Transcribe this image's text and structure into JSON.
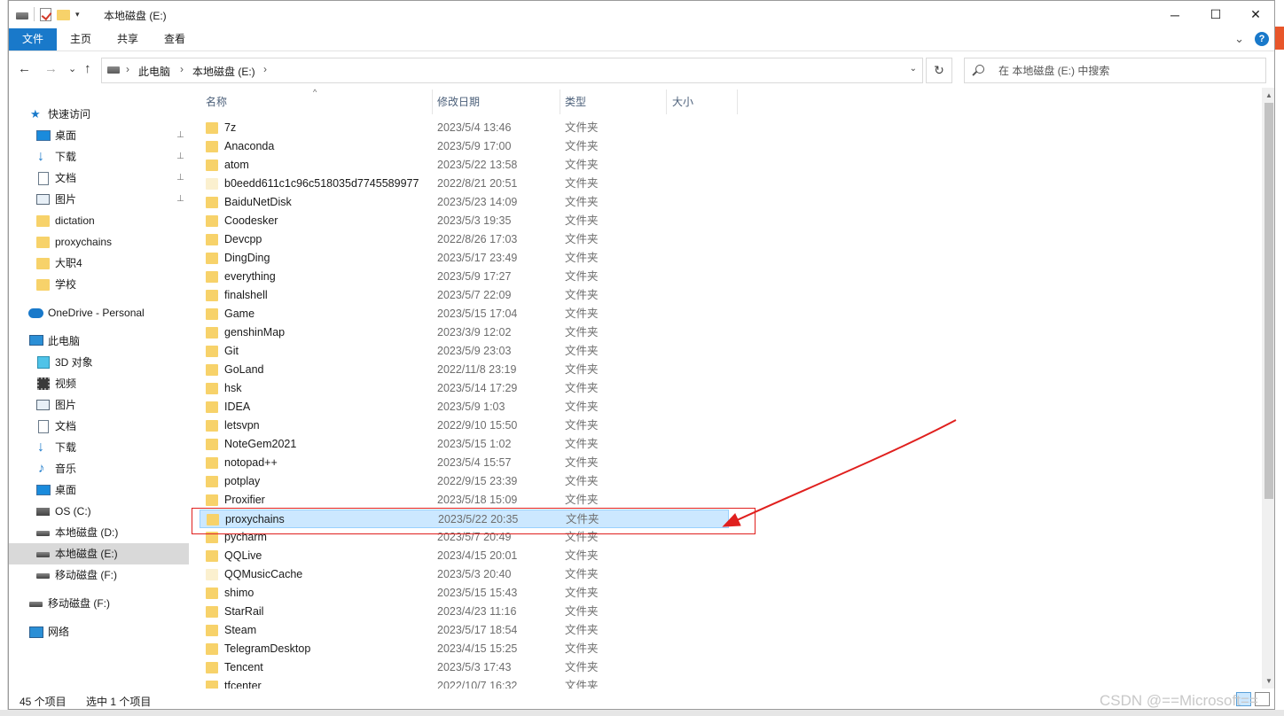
{
  "window": {
    "title": "本地磁盘 (E:)",
    "minimize_glyph": "─",
    "maximize_glyph": "☐",
    "close_glyph": "✕"
  },
  "ribbon": {
    "tabs": [
      "文件",
      "主页",
      "共享",
      "查看"
    ],
    "expand_glyph": "⌄",
    "help_glyph": "?"
  },
  "address": {
    "back_glyph": "←",
    "forward_glyph": "→",
    "recent_glyph": "⌄",
    "up_glyph": "↑",
    "crumbs": [
      "此电脑",
      "本地磁盘 (E:)"
    ],
    "crumb_sep": "›",
    "dropdown_glyph": "⌄",
    "refresh_glyph": "↻",
    "search_placeholder": "在 本地磁盘 (E:) 中搜索"
  },
  "sidebar": {
    "items": [
      {
        "label": "快速访问",
        "icon": "star-icon"
      },
      {
        "label": "桌面",
        "icon": "desktop-icon",
        "pinned": true
      },
      {
        "label": "下载",
        "icon": "download-icon",
        "pinned": true
      },
      {
        "label": "文档",
        "icon": "document-icon",
        "pinned": true
      },
      {
        "label": "图片",
        "icon": "picture-icon",
        "pinned": true
      },
      {
        "label": "dictation",
        "icon": "folder-icon"
      },
      {
        "label": "proxychains",
        "icon": "folder-icon"
      },
      {
        "label": "大职4",
        "icon": "folder-icon"
      },
      {
        "label": "学校",
        "icon": "folder-icon"
      },
      {
        "label": "OneDrive - Personal",
        "icon": "cloud-icon"
      },
      {
        "label": "此电脑",
        "icon": "computer-icon"
      },
      {
        "label": "3D 对象",
        "icon": "3d-objects-icon"
      },
      {
        "label": "视频",
        "icon": "video-icon"
      },
      {
        "label": "图片",
        "icon": "picture-icon"
      },
      {
        "label": "文档",
        "icon": "document-icon"
      },
      {
        "label": "下载",
        "icon": "download-icon"
      },
      {
        "label": "音乐",
        "icon": "music-icon"
      },
      {
        "label": "桌面",
        "icon": "desktop-icon"
      },
      {
        "label": "OS (C:)",
        "icon": "os-drive-icon"
      },
      {
        "label": "本地磁盘 (D:)",
        "icon": "drive-icon"
      },
      {
        "label": "本地磁盘 (E:)",
        "icon": "drive-icon",
        "selected": true
      },
      {
        "label": "移动磁盘 (F:)",
        "icon": "drive-icon"
      },
      {
        "label": "移动磁盘 (F:)",
        "icon": "drive-icon"
      },
      {
        "label": "网络",
        "icon": "network-icon"
      }
    ],
    "pin_glyph": "📌"
  },
  "columns": {
    "name": "名称",
    "date": "修改日期",
    "type": "类型",
    "size": "大小",
    "sort_glyph": "^"
  },
  "files": [
    {
      "name": "7z",
      "date": "2023/5/4 13:46",
      "type": "文件夹"
    },
    {
      "name": "Anaconda",
      "date": "2023/5/9 17:00",
      "type": "文件夹"
    },
    {
      "name": "atom",
      "date": "2023/5/22 13:58",
      "type": "文件夹"
    },
    {
      "name": "b0eedd611c1c96c518035d7745589977",
      "date": "2022/8/21 20:51",
      "type": "文件夹",
      "light": true
    },
    {
      "name": "BaiduNetDisk",
      "date": "2023/5/23 14:09",
      "type": "文件夹"
    },
    {
      "name": "Coodesker",
      "date": "2023/5/3 19:35",
      "type": "文件夹"
    },
    {
      "name": "Devcpp",
      "date": "2022/8/26 17:03",
      "type": "文件夹"
    },
    {
      "name": "DingDing",
      "date": "2023/5/17 23:49",
      "type": "文件夹"
    },
    {
      "name": "everything",
      "date": "2023/5/9 17:27",
      "type": "文件夹"
    },
    {
      "name": "finalshell",
      "date": "2023/5/7 22:09",
      "type": "文件夹"
    },
    {
      "name": "Game",
      "date": "2023/5/15 17:04",
      "type": "文件夹"
    },
    {
      "name": "genshinMap",
      "date": "2023/3/9 12:02",
      "type": "文件夹"
    },
    {
      "name": "Git",
      "date": "2023/5/9 23:03",
      "type": "文件夹"
    },
    {
      "name": "GoLand",
      "date": "2022/11/8 23:19",
      "type": "文件夹"
    },
    {
      "name": "hsk",
      "date": "2023/5/14 17:29",
      "type": "文件夹"
    },
    {
      "name": "IDEA",
      "date": "2023/5/9 1:03",
      "type": "文件夹"
    },
    {
      "name": "letsvpn",
      "date": "2022/9/10 15:50",
      "type": "文件夹"
    },
    {
      "name": "NoteGem2021",
      "date": "2023/5/15 1:02",
      "type": "文件夹"
    },
    {
      "name": "notopad++",
      "date": "2023/5/4 15:57",
      "type": "文件夹"
    },
    {
      "name": "potplay",
      "date": "2022/9/15 23:39",
      "type": "文件夹"
    },
    {
      "name": "Proxifier",
      "date": "2023/5/18 15:09",
      "type": "文件夹"
    },
    {
      "name": "proxychains",
      "date": "2023/5/22 20:35",
      "type": "文件夹",
      "selected": true
    },
    {
      "name": "pycharm",
      "date": "2023/5/7 20:49",
      "type": "文件夹"
    },
    {
      "name": "QQLive",
      "date": "2023/4/15 20:01",
      "type": "文件夹"
    },
    {
      "name": "QQMusicCache",
      "date": "2023/5/3 20:40",
      "type": "文件夹",
      "light": true
    },
    {
      "name": "shimo",
      "date": "2023/5/15 15:43",
      "type": "文件夹"
    },
    {
      "name": "StarRail",
      "date": "2023/4/23 11:16",
      "type": "文件夹"
    },
    {
      "name": "Steam",
      "date": "2023/5/17 18:54",
      "type": "文件夹"
    },
    {
      "name": "TelegramDesktop",
      "date": "2023/4/15 15:25",
      "type": "文件夹"
    },
    {
      "name": "Tencent",
      "date": "2023/5/3 17:43",
      "type": "文件夹"
    },
    {
      "name": "tfcenter",
      "date": "2022/10/7 16:32",
      "type": "文件夹"
    }
  ],
  "status": {
    "count": "45 个项目",
    "selection": "选中 1 个项目"
  },
  "watermark": "CSDN @==Microsoft==",
  "colors": {
    "accent": "#1979ca",
    "selection": "#cce8ff",
    "annotation": "#e0201e",
    "folder": "#f7d26a"
  }
}
